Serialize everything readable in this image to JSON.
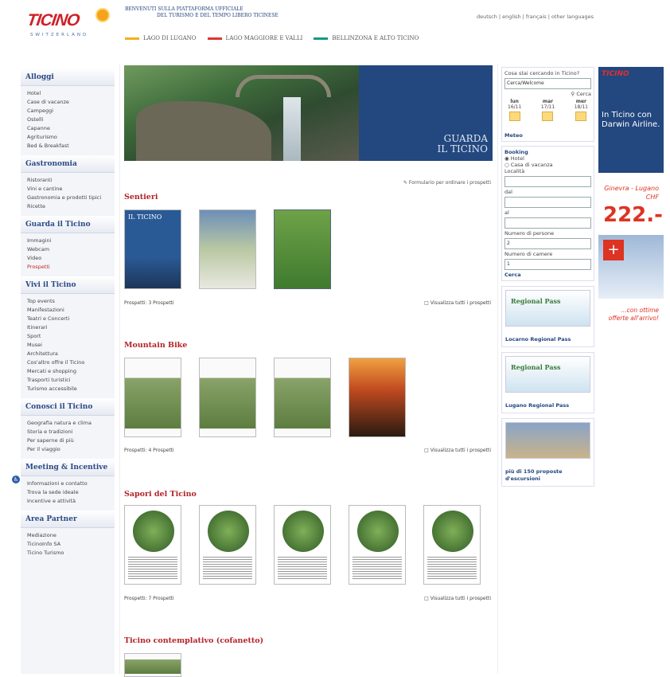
{
  "header": {
    "logo": "TICINO",
    "logo_sub": "SWITZERLAND",
    "welcome_line1": "BENVENUTI SULLA PIATTAFORMA UFFICIALE",
    "welcome_line2": "DEL TURISMO E DEL TEMPO LIBERO TICINESE",
    "languages": "deutsch | english | français | other languages",
    "regions": [
      {
        "label": "LAGO DI LUGANO",
        "color": "#f2b21c"
      },
      {
        "label": "LAGO MAGGIORE E VALLI",
        "color": "#e0342e"
      },
      {
        "label": "BELLINZONA E ALTO TICINO",
        "color": "#159a86"
      }
    ]
  },
  "sidebar": [
    {
      "title": "Alloggi",
      "items": [
        "Hotel",
        "Case di vacanze",
        "Campeggi",
        "Ostelli",
        "Capanne",
        "Agriturismo",
        "Bed & Breakfast"
      ]
    },
    {
      "title": "Gastronomia",
      "items": [
        "Ristoranti",
        "Vini e cantine",
        "Gastronomia e prodotti tipici",
        "Ricette"
      ]
    },
    {
      "title": "Guarda il Ticino",
      "items": [
        "Immagini",
        "Webcam",
        "Video",
        "Prospetti"
      ]
    },
    {
      "title": "Vivi il Ticino",
      "items": [
        "Top events",
        "Manifestazioni",
        "Teatri e Concerti",
        "Itinerari",
        "Sport",
        "Musei",
        "Architettura",
        "Cos'altro offre il Ticino",
        "Mercati e shopping",
        "Trasporti turistici",
        "Turismo accessibile"
      ]
    },
    {
      "title": "Conosci il Ticino",
      "items": [
        "Geografia natura e clima",
        "Storia e tradizioni",
        "Per saperne di più",
        "Per il viaggio"
      ]
    },
    {
      "title": "Meeting & Incentive",
      "items": [
        "Informazioni e contatto",
        "Trova la sede ideale",
        "Incentive e attività"
      ]
    },
    {
      "title": "Area Partner",
      "items": [
        "Mediazione",
        "TicinoInfo SA",
        "Ticino Turismo"
      ]
    }
  ],
  "hero": {
    "line1": "GUARDA",
    "line2": "IL TICINO"
  },
  "order_link": "Formulario per ordinare i prospetti",
  "sections": [
    {
      "title": "Sentieri",
      "count": "Prospetti: 3 Prospetti",
      "viewall": "Visualizza tutti i prospetti"
    },
    {
      "title": "Mountain Bike",
      "count": "Prospetti: 4 Prospetti",
      "viewall": "Visualizza tutti i prospetti"
    },
    {
      "title": "Sapori del Ticino",
      "count": "Prospetti: 7 Prospetti",
      "viewall": "Visualizza tutti i prospetti"
    },
    {
      "title": "Ticino contemplativo (cofanetto)"
    }
  ],
  "thumb_text": "IL TICINO",
  "booking": {
    "question": "Cosa stai cercando in Ticino?",
    "query": "Cerca/Welcome",
    "search": "Cerca",
    "days": [
      {
        "d": "lun",
        "date": "16/11"
      },
      {
        "d": "mar",
        "date": "17/11"
      },
      {
        "d": "mer",
        "date": "18/11"
      }
    ],
    "meteo": "Meteo",
    "title": "Booking",
    "opt1": "Hotel",
    "opt2": "Casa di vacanza",
    "loc": "Località",
    "dal": "dal",
    "al": "al",
    "persons": "Numero di persone",
    "persons_val": "2",
    "rooms": "Numero di camere",
    "rooms_val": "1",
    "cerca": "Cerca"
  },
  "promos": [
    {
      "img": "Regional Pass",
      "label": "Locarno Regional Pass"
    },
    {
      "img": "Regional Pass",
      "label": "Lugano Regional Pass"
    },
    {
      "img": "",
      "label": "più di 150 proposte d'escursioni"
    }
  ],
  "ad": {
    "brand": "TICINO",
    "msg": "In Ticino con Darwin Airline.",
    "route": "Ginevra - Lugano CHF",
    "price": "222.-",
    "bottom": "...con ottime offerte all'arrivo!"
  }
}
